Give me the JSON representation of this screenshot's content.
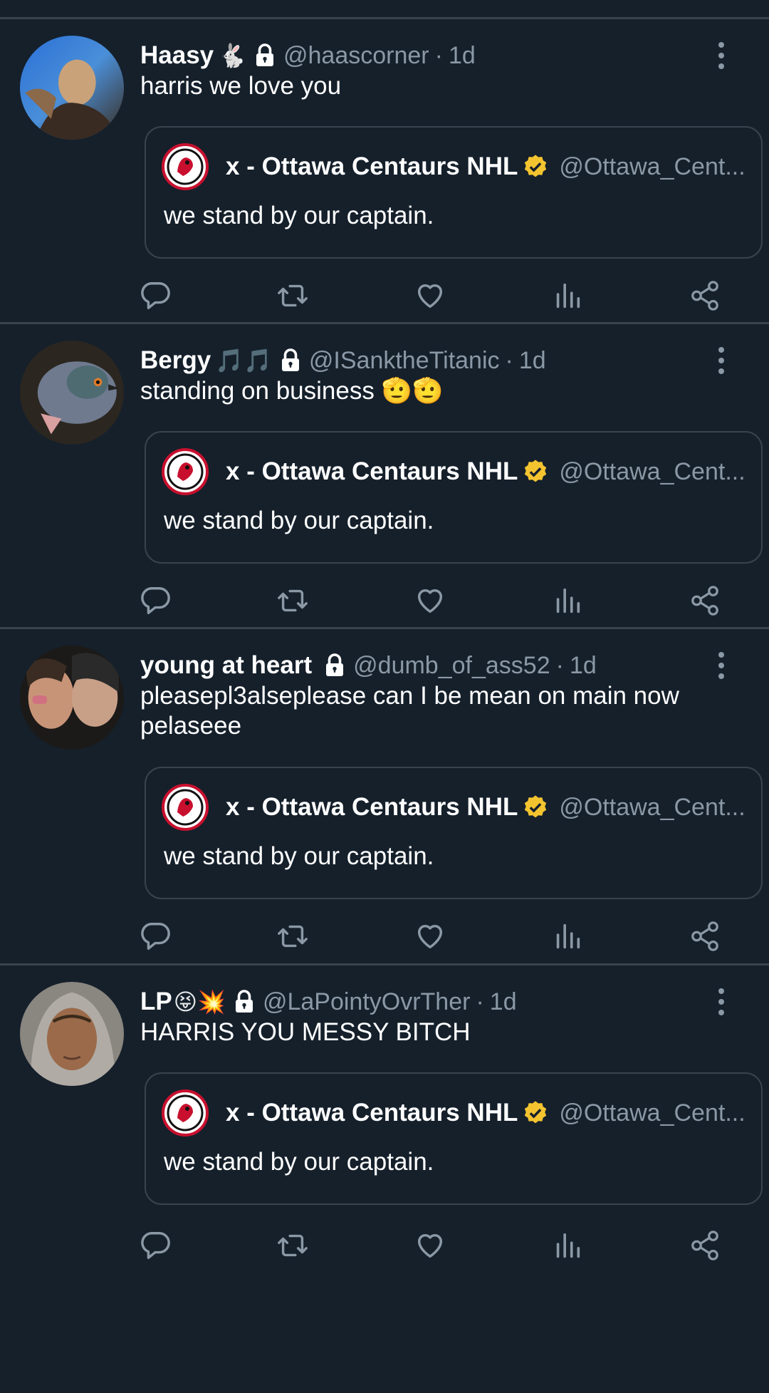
{
  "colors": {
    "background": "#15202b",
    "divider": "#38444d",
    "muted": "#8b98a5",
    "verified": "#f4c430"
  },
  "tweets": [
    {
      "name": "Haasy",
      "emoji": "🐇",
      "handle": "@haascorner",
      "sep": "·",
      "time": "1d",
      "text": "harris we love you",
      "quote": {
        "name": "x - Ottawa Centaurs NHL",
        "handle": "@Ottawa_Cent...",
        "text": "we stand by our captain."
      }
    },
    {
      "name": "Bergy",
      "emoji": "🎵🎵",
      "handle": "@ISanktheTitanic",
      "sep": "·",
      "time": "1d",
      "text": "standing on business 🫡🫡",
      "quote": {
        "name": "x - Ottawa Centaurs NHL",
        "handle": "@Ottawa_Cent...",
        "text": "we stand by our captain."
      }
    },
    {
      "name": "young at heart",
      "emoji": "",
      "handle": "@dumb_of_ass52",
      "sep": "·",
      "time": "1d",
      "text": "pleasepl3alseplease can I be mean on main now pelaseee",
      "quote": {
        "name": "x - Ottawa Centaurs NHL",
        "handle": "@Ottawa_Cent...",
        "text": "we stand by our captain."
      }
    },
    {
      "name": "LP",
      "emoji": "😝💥",
      "handle": "@LaPointyOvrTher",
      "sep": "·",
      "time": "1d",
      "text": "HARRIS YOU MESSY BITCH",
      "quote": {
        "name": "x - Ottawa Centaurs NHL",
        "handle": "@Ottawa_Cent...",
        "text": "we stand by our captain."
      }
    }
  ],
  "icons": {
    "reply": "reply-icon",
    "retweet": "retweet-icon",
    "like": "heart-icon",
    "views": "analytics-icon",
    "share": "share-icon",
    "more": "more-vertical-icon",
    "lock": "lock-icon",
    "verified": "verified-badge-icon"
  }
}
